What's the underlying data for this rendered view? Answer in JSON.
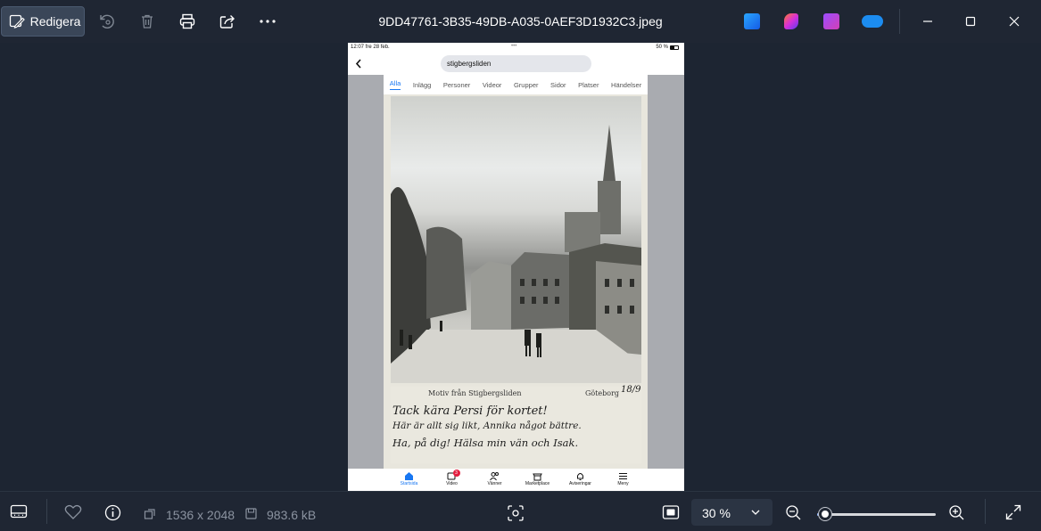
{
  "toolbar": {
    "edit_label": "Redigera",
    "file_name": "9DD47761-3B35-49DB-A035-0AEF3D1932C3.jpeg"
  },
  "phone": {
    "status_time": "12:07  fre 28 feb.",
    "status_dots": "•••",
    "status_battery": "50 %",
    "search_value": "stigbergsliden",
    "tabs": [
      "Alla",
      "Inlägg",
      "Personer",
      "Videor",
      "Grupper",
      "Sidor",
      "Platser",
      "Händelser"
    ],
    "postcard": {
      "print_line": "Motiv från Stigbergsliden",
      "print_city": "Göteborg",
      "hand_year": "18/9",
      "hand_line1": "Tack kära Persi för kortet!",
      "hand_line2": "Här är allt sig likt, Annika något bättre.",
      "hand_line3": "Ha, på dig! Hälsa min vän och Isak."
    },
    "bottomnav": [
      {
        "label": "Startsida",
        "icon": "home-icon"
      },
      {
        "label": "Video",
        "icon": "video-icon",
        "badge": "3"
      },
      {
        "label": "Vänner",
        "icon": "friends-icon"
      },
      {
        "label": "Marketplace",
        "icon": "marketplace-icon"
      },
      {
        "label": "Aviseringar",
        "icon": "bell-icon"
      },
      {
        "label": "Meny",
        "icon": "menu-icon"
      }
    ]
  },
  "statusbar": {
    "dimensions": "1536 x 2048",
    "file_size": "983.6 kB",
    "zoom": "30 %",
    "zoom_level": 0.07
  },
  "colors": {
    "accent": "#1877f2",
    "background": "#1d2532"
  }
}
